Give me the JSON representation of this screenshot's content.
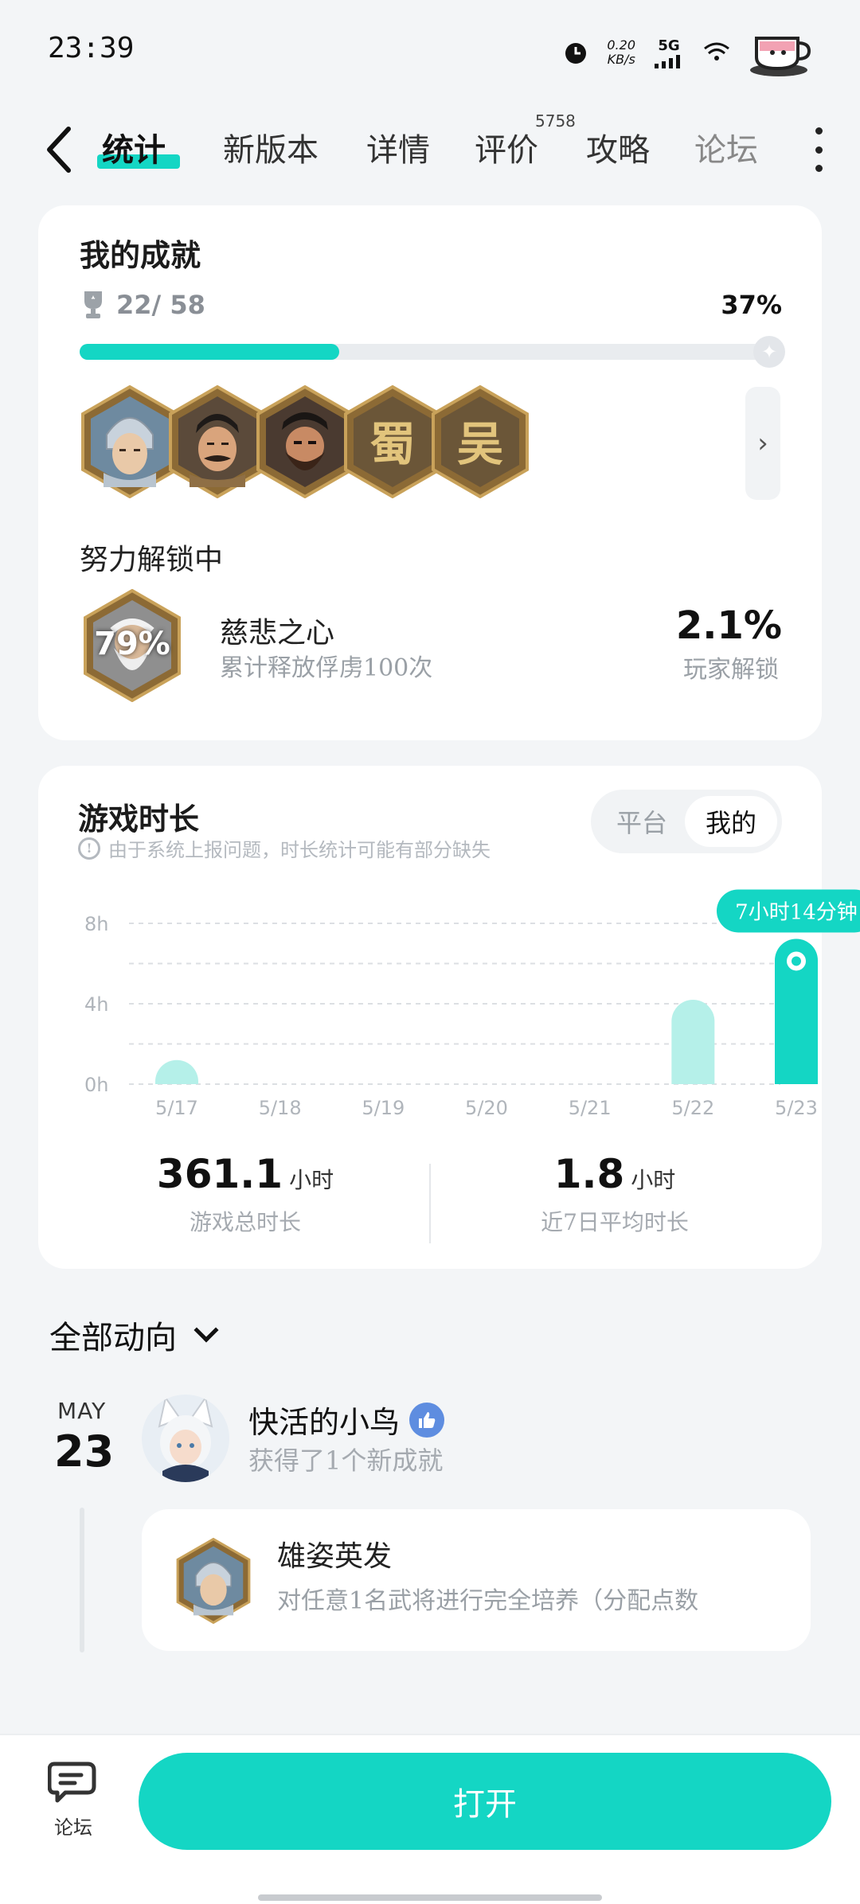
{
  "status_bar": {
    "time": "23:39",
    "net_speed": "0.20",
    "net_unit": "KB/s",
    "network": "5G",
    "colors": {
      "text": "#111111"
    }
  },
  "tabs": [
    {
      "label": "统计",
      "active": true
    },
    {
      "label": "新版本"
    },
    {
      "label": "详情"
    },
    {
      "label": "评价",
      "badge": "5758"
    },
    {
      "label": "攻略"
    },
    {
      "label": "论坛"
    }
  ],
  "achievements": {
    "title": "我的成就",
    "count": "22/ 58",
    "percent": "37%",
    "progress": 0.37,
    "badges": [
      {
        "icon": "warrior-silver-helmet-icon"
      },
      {
        "icon": "warrior-mustache-icon"
      },
      {
        "icon": "warrior-beard-icon"
      },
      {
        "icon": "shu-seal-icon",
        "glyph": "蜀"
      },
      {
        "icon": "wu-seal-icon",
        "glyph": "吴"
      }
    ],
    "unlocking": {
      "title": "努力解锁中",
      "badge_pct": "79%",
      "name": "慈悲之心",
      "desc": "累计释放俘虏100次",
      "rate": "2.1%",
      "rate_label": "玩家解锁"
    }
  },
  "playtime": {
    "title": "游戏时长",
    "note": "由于系统上报问题，时长统计可能有部分缺失",
    "segments": {
      "left": "平台",
      "right": "我的"
    },
    "selected": "我的",
    "stats": [
      {
        "value": "361.1",
        "unit": "小时",
        "label": "游戏总时长"
      },
      {
        "value": "1.8",
        "unit": "小时",
        "label": "近7日平均时长"
      }
    ]
  },
  "chart_data": {
    "type": "bar",
    "categories": [
      "5/17",
      "5/18",
      "5/19",
      "5/20",
      "5/21",
      "5/22",
      "5/23"
    ],
    "values": [
      1.2,
      0,
      0,
      0,
      0,
      4.2,
      7.23
    ],
    "yticks": [
      "8h",
      "4h",
      "0h"
    ],
    "ylim": [
      0,
      8
    ],
    "highlight_index": 6,
    "tooltip": "7小时14分钟",
    "colors": {
      "bar": "#b5f0e9",
      "highlight": "#14d6c4",
      "grid": "#dcdfe3",
      "tick": "#b0b5bb"
    }
  },
  "feed": {
    "header": "全部动向",
    "date": {
      "month": "MAY",
      "day": "23"
    },
    "user": "快活的小鸟",
    "subtitle": "获得了1个新成就",
    "achievement": {
      "title": "雄姿英发",
      "desc": "对任意1名武将进行完全培养（分配点数",
      "icon": "warrior-silver-helmet-icon"
    }
  },
  "bottom_bar": {
    "forum_label": "论坛",
    "open_label": "打开",
    "colors": {
      "accent": "#14d6c4"
    }
  }
}
